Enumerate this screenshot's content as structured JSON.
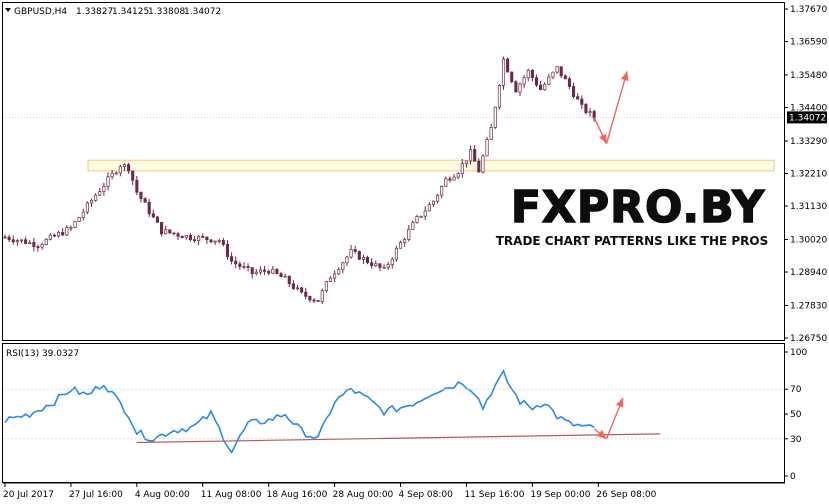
{
  "chart_data": [
    {
      "type": "candlestick",
      "title": "GBPUSD,H4",
      "ohlc": {
        "open": "1.33827",
        "high": "1.34125",
        "low": "1.33808",
        "close": "1.34072"
      },
      "current_price": 1.34072,
      "current_price_label": "1.34072",
      "ylim": [
        1.2675,
        1.3767
      ],
      "y_ticks": [
        "1.37670",
        "1.36590",
        "1.35480",
        "1.34400",
        "1.33290",
        "1.32210",
        "1.31130",
        "1.30020",
        "1.28940",
        "1.27830",
        "1.26750"
      ],
      "y_tick_values": [
        1.3767,
        1.3659,
        1.3548,
        1.344,
        1.3329,
        1.3221,
        1.3113,
        1.3002,
        1.2894,
        1.2783,
        1.2675
      ],
      "x_ticks": [
        "20 Jul 2017",
        "27 Jul 16:00",
        "4 Aug 00:00",
        "11 Aug 08:00",
        "18 Aug 16:00",
        "28 Aug 00:00",
        "4 Sep 08:00",
        "11 Sep 16:00",
        "19 Sep 00:00",
        "26 Sep 08:00"
      ],
      "bar_count": 144,
      "closes_anchor": [
        [
          0,
          1.301
        ],
        [
          8,
          1.2985
        ],
        [
          16,
          1.304
        ],
        [
          22,
          1.315
        ],
        [
          28,
          1.325
        ],
        [
          30,
          1.324
        ],
        [
          32,
          1.316
        ],
        [
          38,
          1.303
        ],
        [
          45,
          1.301
        ],
        [
          52,
          1.3
        ],
        [
          55,
          1.293
        ],
        [
          60,
          1.289
        ],
        [
          64,
          1.29
        ],
        [
          68,
          1.287
        ],
        [
          72,
          1.282
        ],
        [
          76,
          1.28
        ],
        [
          79,
          1.288
        ],
        [
          84,
          1.296
        ],
        [
          88,
          1.293
        ],
        [
          92,
          1.29
        ],
        [
          96,
          1.299
        ],
        [
          100,
          1.307
        ],
        [
          104,
          1.313
        ],
        [
          107,
          1.32
        ],
        [
          110,
          1.323
        ],
        [
          113,
          1.329
        ],
        [
          115,
          1.323
        ],
        [
          118,
          1.337
        ],
        [
          121,
          1.36
        ],
        [
          124,
          1.35
        ],
        [
          127,
          1.356
        ],
        [
          130,
          1.35
        ],
        [
          134,
          1.357
        ],
        [
          137,
          1.351
        ],
        [
          140,
          1.344
        ],
        [
          143,
          1.3407
        ]
      ],
      "support_zone": [
        1.323,
        1.3265
      ],
      "price_arrows": [
        {
          "from": [
            143,
            1.3407
          ],
          "to": [
            146,
            1.332
          ]
        },
        {
          "from": [
            146,
            1.332
          ],
          "to": [
            151,
            1.356
          ]
        }
      ]
    },
    {
      "type": "line",
      "title": "RSI(13) 39.0327",
      "ylim": [
        0,
        100
      ],
      "y_ticks": [
        "100",
        "70",
        "50",
        "30",
        "0"
      ],
      "y_tick_values": [
        100,
        70,
        50,
        30,
        0
      ],
      "levels": [
        70,
        30
      ],
      "series": [
        {
          "name": "RSI(13)",
          "anchors": [
            [
              0,
              45
            ],
            [
              6,
              50
            ],
            [
              12,
              60
            ],
            [
              16,
              70
            ],
            [
              20,
              65
            ],
            [
              24,
              75
            ],
            [
              30,
              50
            ],
            [
              32,
              35
            ],
            [
              36,
              30
            ],
            [
              40,
              36
            ],
            [
              46,
              40
            ],
            [
              50,
              50
            ],
            [
              55,
              20
            ],
            [
              59,
              42
            ],
            [
              64,
              45
            ],
            [
              68,
              50
            ],
            [
              72,
              36
            ],
            [
              76,
              30
            ],
            [
              80,
              60
            ],
            [
              84,
              70
            ],
            [
              88,
              62
            ],
            [
              92,
              52
            ],
            [
              96,
              55
            ],
            [
              100,
              60
            ],
            [
              104,
              68
            ],
            [
              108,
              72
            ],
            [
              111,
              76
            ],
            [
              114,
              68
            ],
            [
              116,
              55
            ],
            [
              118,
              68
            ],
            [
              121,
              82
            ],
            [
              123,
              70
            ],
            [
              125,
              60
            ],
            [
              128,
              55
            ],
            [
              131,
              60
            ],
            [
              134,
              48
            ],
            [
              137,
              42
            ],
            [
              140,
              40
            ],
            [
              143,
              38
            ]
          ]
        }
      ],
      "trendline": {
        "from": [
          32,
          27
        ],
        "to": [
          159,
          34
        ]
      },
      "rsi_arrows": [
        {
          "from": [
            143,
            38
          ],
          "to": [
            146,
            30
          ]
        },
        {
          "from": [
            146,
            30
          ],
          "to": [
            150,
            63
          ]
        }
      ]
    }
  ],
  "watermark": {
    "brand": "FXPRO.BY",
    "tagline": "TRADE CHART PATTERNS LIKE THE PROS"
  },
  "colors": {
    "background": "#ffffff",
    "candle": "#6a2a4c",
    "zone_fill": "#fffbe0",
    "zone_border": "#f2c97c",
    "rsi_line": "#2a8ae8",
    "trend_line": "#b85a5a",
    "arrow": "#f0665c",
    "price_label_bg": "#000000",
    "price_label_text": "#ffffff"
  }
}
